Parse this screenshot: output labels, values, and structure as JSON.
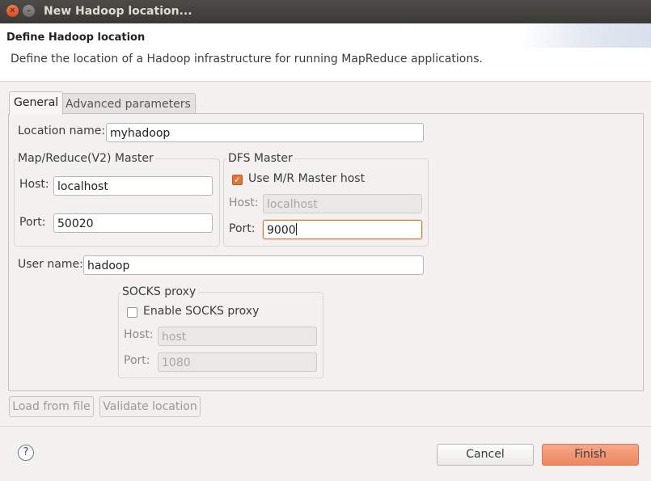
{
  "window": {
    "title": "New Hadoop location..."
  },
  "header": {
    "title": "Define Hadoop location",
    "description": "Define the location of a Hadoop infrastructure for running MapReduce applications."
  },
  "tabs": [
    {
      "label": "General",
      "selected": true
    },
    {
      "label": "Advanced parameters",
      "selected": false
    }
  ],
  "general": {
    "location_name_label": "Location name:",
    "location_name_value": "myhadoop",
    "mr_master": {
      "title": "Map/Reduce(V2) Master",
      "host_label": "Host:",
      "host_value": "localhost",
      "port_label": "Port:",
      "port_value": "50020"
    },
    "dfs_master": {
      "title": "DFS Master",
      "use_mr_label": "Use M/R Master host",
      "use_mr_checked": true,
      "host_label": "Host:",
      "host_value": "localhost",
      "port_label": "Port:",
      "port_value": "9000"
    },
    "user_name_label": "User name:",
    "user_name_value": "hadoop",
    "socks": {
      "title": "SOCKS proxy",
      "enable_label": "Enable SOCKS proxy",
      "enable_checked": false,
      "host_label": "Host:",
      "host_value": "host",
      "port_label": "Port:",
      "port_value": "1080"
    }
  },
  "actions": {
    "load_from_file": "Load from file",
    "validate_location": "Validate location"
  },
  "footer": {
    "help_icon": "?",
    "cancel": "Cancel",
    "finish": "Finish"
  },
  "colors": {
    "accent": "#e0753b",
    "finish_button": "#ec8761",
    "titlebar": "#3b3a36"
  }
}
